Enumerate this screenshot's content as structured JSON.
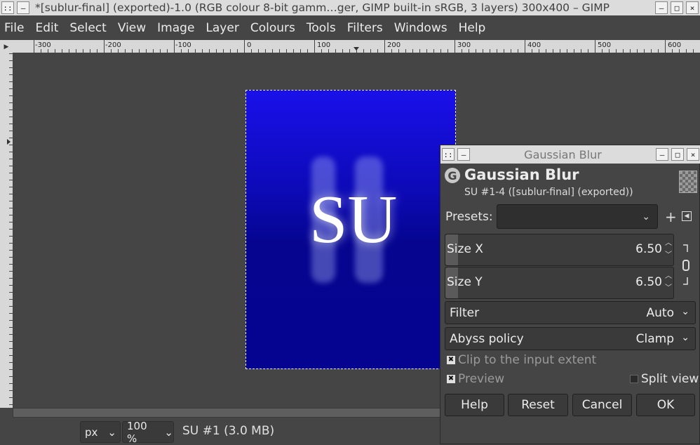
{
  "window": {
    "title": "*[sublur-final] (exported)-1.0 (RGB colour 8-bit gamm…ger, GIMP built-in sRGB, 3 layers) 300x400 – GIMP"
  },
  "menu": [
    "File",
    "Edit",
    "Select",
    "View",
    "Image",
    "Layer",
    "Colours",
    "Tools",
    "Filters",
    "Windows",
    "Help"
  ],
  "ruler": {
    "top_ticks": [
      "-300",
      "-200",
      "-100",
      "0",
      "100",
      "200",
      "300",
      "400",
      "500",
      "600"
    ]
  },
  "image": {
    "text": "SU",
    "background_top": "#1a10ea",
    "background_bottom": "#040490"
  },
  "statusbar": {
    "unit": "px",
    "zoom": "100 %",
    "info": "SU #1 (3.0 MB)"
  },
  "dialog": {
    "window_title": "Gaussian Blur",
    "title": "Gaussian Blur",
    "subtitle": "SU #1-4 ([sublur-final] (exported))",
    "presets_label": "Presets:",
    "presets_value": "",
    "size_x_label": "Size X",
    "size_x_value": "6.50",
    "size_y_label": "Size Y",
    "size_y_value": "6.50",
    "filter_label": "Filter",
    "filter_value": "Auto",
    "abyss_label": "Abyss policy",
    "abyss_value": "Clamp",
    "clip_label": "Clip to the input extent",
    "preview_label": "Preview",
    "split_label": "Split view",
    "buttons": {
      "help": "Help",
      "reset": "Reset",
      "cancel": "Cancel",
      "ok": "OK"
    }
  }
}
